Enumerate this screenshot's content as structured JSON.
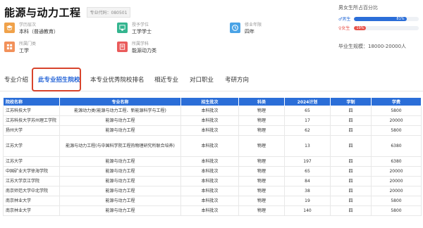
{
  "header": {
    "title": "能源与动力工程",
    "code_label": "专业代码：080501"
  },
  "info": [
    {
      "key": "学历层次",
      "value": "本科（普通教育）",
      "icon": "graduation-cap-icon",
      "color": "#f0a24a"
    },
    {
      "key": "授予学位",
      "value": "工学学士",
      "icon": "degree-certificate-icon",
      "color": "#34b58f"
    },
    {
      "key": "修业年限",
      "value": "四年",
      "icon": "clock-icon",
      "color": "#4aa3e6"
    },
    {
      "key": "所属门类",
      "value": "工学",
      "icon": "category-grid-icon",
      "color": "#f2915a"
    },
    {
      "key": "所属学科",
      "value": "能源动力类",
      "icon": "discipline-book-icon",
      "color": "#ea5b5b"
    }
  ],
  "gender": {
    "title": "男女生所占百分比",
    "male_label": "♂男生",
    "male_pct": 81,
    "male_text": "81%",
    "male_color": "#2b6ed8",
    "female_label": "♀女生",
    "female_pct": 19,
    "female_text": "19%",
    "female_color": "#e8534b",
    "salary": "毕业生规模：18000-20000人"
  },
  "tabs": [
    "专业介绍",
    "此专业招生院校",
    "本专业优秀院校排名",
    "相近专业",
    "对口职业",
    "考研方向"
  ],
  "table": {
    "headers": [
      "院校名称",
      "专业名称",
      "招生批次",
      "科类",
      "2024计划",
      "学制",
      "学费"
    ],
    "rows": [
      [
        "江苏科技大学",
        "能源动力类(能源与动力工程、新能源科学与工程)",
        "本科批次",
        "物理",
        "65",
        "四",
        "5800"
      ],
      [
        "江苏科技大学苏州理工学院",
        "能源与动力工程",
        "本科批次",
        "物理",
        "17",
        "四",
        "20000"
      ],
      [
        "扬州大学",
        "能源与动力工程",
        "本科批次",
        "物理",
        "62",
        "四",
        "5800"
      ],
      [
        "江苏大学",
        "能源与动力工程(与中国科学院工程热物理研究所联合培养)",
        "本科批次",
        "物理",
        "13",
        "四",
        "6380"
      ],
      [
        "江苏大学",
        "能源与动力工程",
        "本科批次",
        "物理",
        "197",
        "四",
        "6380"
      ],
      [
        "中国矿业大学徐海学院",
        "能源与动力工程",
        "本科批次",
        "物理",
        "65",
        "四",
        "20000"
      ],
      [
        "江苏大学京江学院",
        "能源与动力工程",
        "本科批次",
        "物理",
        "84",
        "四",
        "20000"
      ],
      [
        "南京师范大学中北学院",
        "能源与动力工程",
        "本科批次",
        "物理",
        "38",
        "四",
        "20000"
      ],
      [
        "南京林业大学",
        "能源与动力工程",
        "本科批次",
        "物理",
        "19",
        "四",
        "5800"
      ],
      [
        "南京林业大学",
        "能源与动力工程",
        "本科批次",
        "物理",
        "140",
        "四",
        "5800"
      ]
    ]
  }
}
